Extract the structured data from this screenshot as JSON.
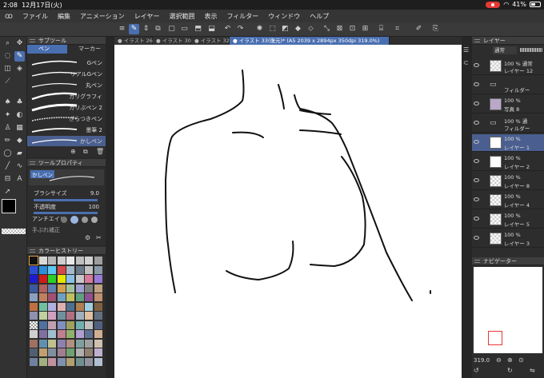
{
  "status": {
    "time": "2:08",
    "date": "12月17日(火)",
    "battery": "41%"
  },
  "menu": [
    "ファイル",
    "編集",
    "アニメーション",
    "レイヤー",
    "選択範囲",
    "表示",
    "フィルター",
    "ウィンドウ",
    "ヘルプ"
  ],
  "subtool": {
    "title": "サブツール",
    "tabs": [
      "ペン",
      "マーカー"
    ],
    "brushes": [
      "Gペン",
      "リアルGペン",
      "丸ペン",
      "カリグラフィ",
      "ガリぶペン 2",
      "ざらつきペン",
      "墨筆 2",
      "かしペン"
    ]
  },
  "toolprop": {
    "title": "ツールプロパティ",
    "preset": "かしペン",
    "brush_size_label": "ブラシサイズ",
    "brush_size": "9.0",
    "opacity_label": "不透明度",
    "opacity": "100",
    "antialias_label": "アンチエイリ",
    "extra_label": "手ぶれ補正"
  },
  "colorhist": {
    "title": "カラーヒストリー"
  },
  "tabs": [
    {
      "label": "● イラスト 26(復"
    },
    {
      "label": "● イラスト 30(復"
    },
    {
      "label": "● イラスト 32(復"
    },
    {
      "label": "● イラスト 33(復元)* (A5 2039 x 2894px 350dpi 319.0%)"
    }
  ],
  "layers": {
    "title": "レイヤー",
    "blend": "通常",
    "rows": [
      {
        "t1": "100 % 通常",
        "t2": "レイヤー 12",
        "thumb": "chk"
      },
      {
        "t1": "",
        "t2": "フィルダー",
        "thumb": "fold"
      },
      {
        "t1": "100 %",
        "t2": "写真 8",
        "thumb": "img"
      },
      {
        "t1": "100 % 通",
        "t2": "フィルダー",
        "thumb": "fold"
      },
      {
        "t1": "100 %",
        "t2": "レイヤー 1",
        "thumb": "white",
        "on": true
      },
      {
        "t1": "100 %",
        "t2": "レイヤー 2",
        "thumb": "white"
      },
      {
        "t1": "100 %",
        "t2": "レイヤー 8",
        "thumb": "chk"
      },
      {
        "t1": "100 %",
        "t2": "レイヤー 4",
        "thumb": "chk"
      },
      {
        "t1": "100 %",
        "t2": "レイヤー 5",
        "thumb": "chk"
      },
      {
        "t1": "100 %",
        "t2": "レイヤー 3",
        "thumb": "chk"
      }
    ]
  },
  "navigator": {
    "title": "ナビゲーター",
    "zoom": "319.0"
  },
  "colors": {
    "accent": "#4a6fb0",
    "bg": "#2d2d2d",
    "canvas": "#ffffff",
    "stroke": "#111111"
  }
}
